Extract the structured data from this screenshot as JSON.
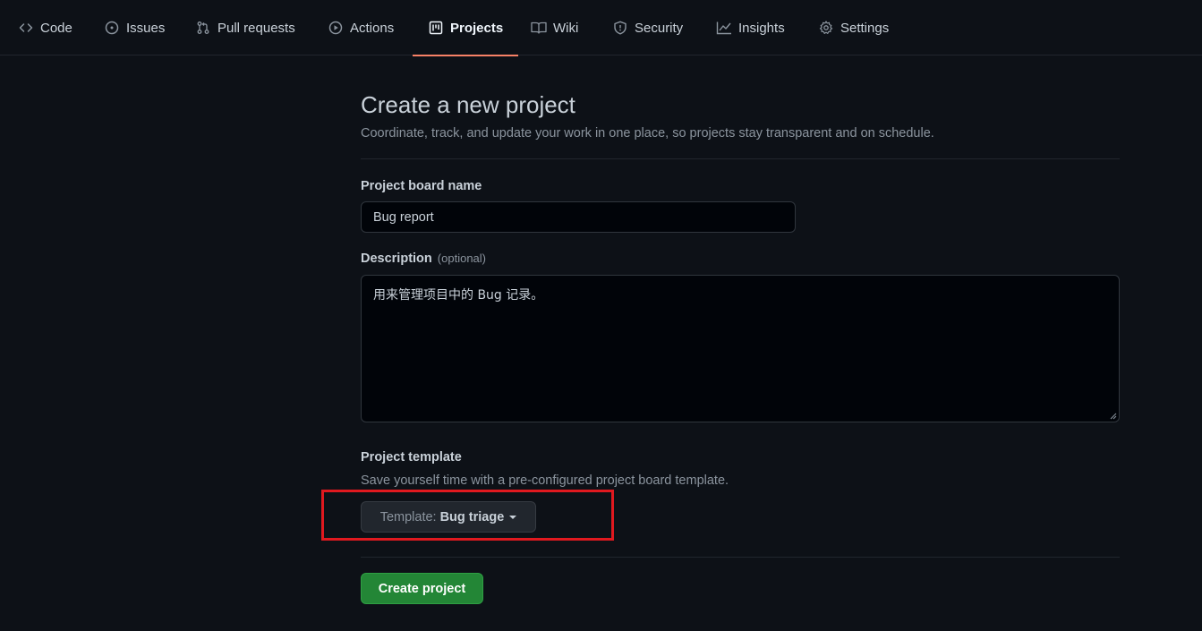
{
  "nav": {
    "tabs": [
      {
        "label": "Code",
        "icon": "code-icon"
      },
      {
        "label": "Issues",
        "icon": "issue-opened-icon"
      },
      {
        "label": "Pull requests",
        "icon": "git-pull-request-icon"
      },
      {
        "label": "Actions",
        "icon": "play-icon"
      },
      {
        "label": "Projects",
        "icon": "project-icon",
        "selected": true
      },
      {
        "label": "Wiki",
        "icon": "book-icon"
      },
      {
        "label": "Security",
        "icon": "shield-icon"
      },
      {
        "label": "Insights",
        "icon": "graph-icon"
      },
      {
        "label": "Settings",
        "icon": "gear-icon"
      }
    ]
  },
  "form": {
    "title": "Create a new project",
    "subtitle": "Coordinate, track, and update your work in one place, so projects stay transparent and on schedule.",
    "name_label": "Project board name",
    "name_value": "Bug report",
    "description_label": "Description",
    "description_optional": "(optional)",
    "description_value": "用来管理项目中的 Bug 记录。",
    "template_label": "Project template",
    "template_hint": "Save yourself time with a pre-configured project board template.",
    "template_prefix": "Template:",
    "template_value": "Bug triage",
    "submit_label": "Create project"
  },
  "colors": {
    "background": "#0d1117",
    "selected_tab_underline": "#f78166",
    "primary_button": "#238636",
    "annotation_box": "#e0191f"
  }
}
